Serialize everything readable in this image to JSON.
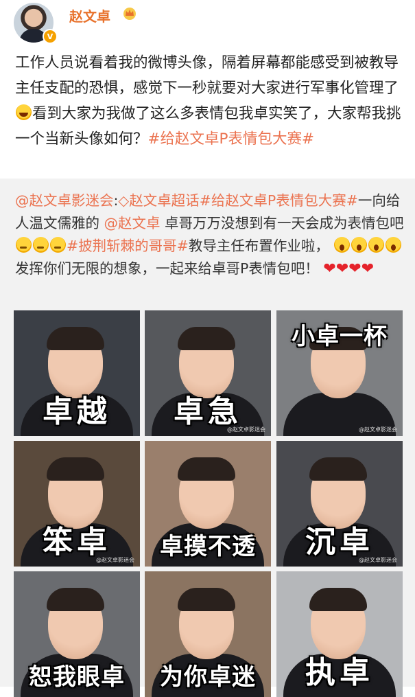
{
  "author": {
    "name": "赵文卓",
    "verified_badge": "V",
    "crown_icon": "crown-icon"
  },
  "post": {
    "text_before_emoji": "工作人员说看着我的微博头像，隔着屏幕都能感受到被教导主任支配的恐惧，感觉下一秒就要对大家进行军事化管理了",
    "text_after_emoji": "看到大家为我做了这么多表情包我卓实笑了，大家帮我挑一个当新头像如何？",
    "hashtag": "#给赵文卓P表情包大赛#"
  },
  "repost": {
    "mention": "@赵文卓影迷会",
    "colon": ":",
    "super_topic_icon": "diamond-icon",
    "super_topic": "赵文卓超话",
    "hashtag": "#给赵文卓P表情包大赛#",
    "text1": "一向给人温文儒雅的",
    "mention2": "@赵文卓",
    "text2": " 卓哥万万没想到有一天会成为表情包吧",
    "hashtag2": "#披荆斩棘的哥哥#",
    "text3": "教导主任布置作业啦，",
    "text4": "发挥你们无限的想象，一起来给卓哥P表情包吧！",
    "hearts": [
      "❤",
      "❤",
      "❤",
      "❤"
    ]
  },
  "memes": [
    {
      "caption": "卓越",
      "position": "bottom",
      "bg": "#3b3f46",
      "watermark": ""
    },
    {
      "caption": "卓急",
      "position": "bottom",
      "bg": "#56585c",
      "watermark": "@赵文卓影迷会"
    },
    {
      "caption": "小卓一杯",
      "position": "top",
      "bg": "#7d7f82",
      "watermark": "@赵文卓影迷会"
    },
    {
      "caption": "笨卓",
      "position": "bottom",
      "bg": "#5a4a3c",
      "watermark": "@赵文卓影迷会"
    },
    {
      "caption": "卓摸不透",
      "position": "bottom",
      "bg": "#9a7f6c",
      "watermark": ""
    },
    {
      "caption": "沉卓",
      "position": "bottom",
      "bg": "#494a4f",
      "watermark": "@赵文卓影迷会"
    },
    {
      "caption": "恕我眼卓",
      "position": "bottom",
      "bg": "#6a6c70",
      "watermark": ""
    },
    {
      "caption": "为你卓迷",
      "position": "bottom",
      "bg": "#8b7461",
      "watermark": ""
    },
    {
      "caption": "执卓",
      "position": "bottom",
      "bg": "#b5b7ba",
      "watermark": ""
    }
  ]
}
